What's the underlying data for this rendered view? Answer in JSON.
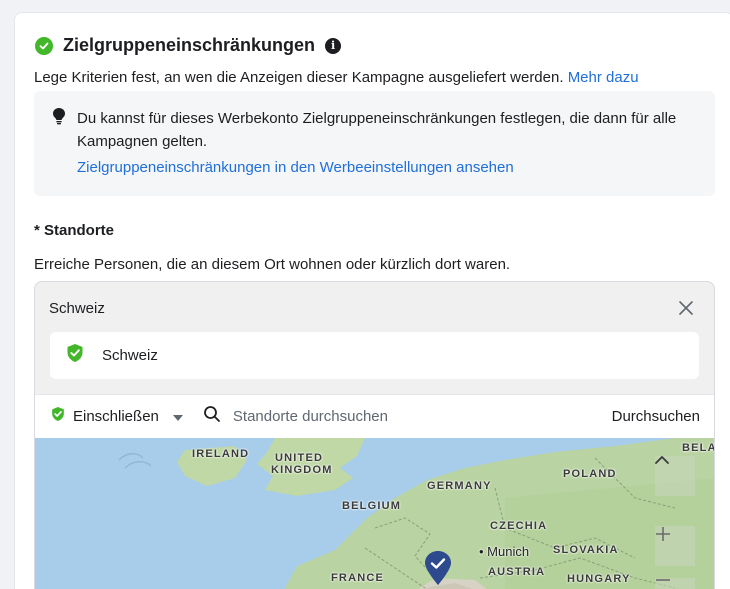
{
  "header": {
    "title": "Zielgruppeneinschränkungen",
    "description": "Lege Kriterien fest, an wen die Anzeigen dieser Kampagne ausgeliefert werden.",
    "more_link": "Mehr dazu"
  },
  "tip": {
    "text": "Du kannst für dieses Werbekonto Zielgruppeneinschränkungen festlegen, die dann für alle Kampagnen gelten.",
    "link": "Zielgruppeneinschränkungen in den Werbeeinstellungen ansehen"
  },
  "locations": {
    "label": "* Standorte",
    "description": "Erreiche Personen, die an diesem Ort wohnen oder kürzlich dort waren.",
    "current": "Schweiz",
    "selected": [
      "Schweiz"
    ],
    "include_mode": "Einschließen",
    "search_placeholder": "Standorte durchsuchen",
    "search_button": "Durchsuchen"
  },
  "map": {
    "labels": {
      "ireland": "IRELAND",
      "uk_line1": "UNITED",
      "uk_line2": "KINGDOM",
      "germany": "GERMANY",
      "belgium": "BELGIUM",
      "poland": "POLAND",
      "czechia": "CZECHIA",
      "munich": "Munich",
      "slovakia": "SLOVAKIA",
      "austria": "AUSTRIA",
      "hungary": "HUNGARY",
      "france": "FRANCE",
      "belarus_partial": "BELA"
    },
    "controls": {
      "collapse": "^",
      "zoom_in": "+",
      "zoom_out": "−"
    }
  },
  "colors": {
    "accent_green": "#42b72a",
    "link_blue": "#216fdb",
    "pin_blue": "#2e4a8f"
  }
}
